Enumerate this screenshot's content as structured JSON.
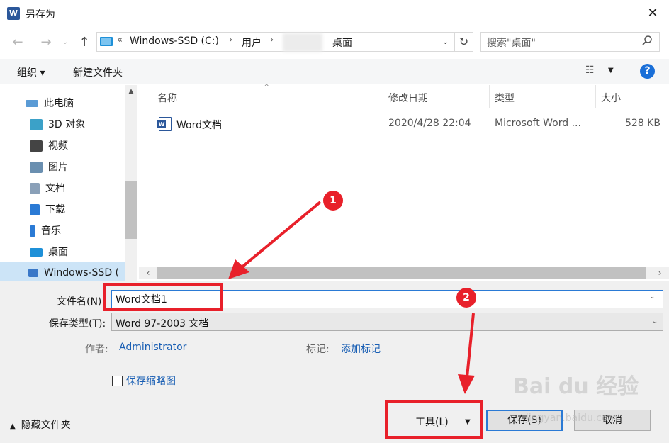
{
  "window": {
    "app_icon_glyph": "W",
    "title": "另存为",
    "close_glyph": "✕"
  },
  "navigation": {
    "back_glyph": "←",
    "forward_glyph": "→",
    "recent_glyph": "⌄",
    "up_glyph": "↑"
  },
  "address": {
    "overflow": "«",
    "crumbs": [
      "Windows-SSD (C:)",
      "用户",
      "桌面"
    ],
    "separator": "›",
    "dropdown_glyph": "⌄",
    "refresh_glyph": "↻"
  },
  "search": {
    "placeholder": "搜索\"桌面\"",
    "icon": "search-icon"
  },
  "toolbar": {
    "organize_label": "组织 ▾",
    "new_folder_label": "新建文件夹",
    "view_glyph": "☷",
    "view_dropdown_glyph": "▼",
    "help_glyph": "?"
  },
  "sidebar": {
    "items": [
      {
        "label": "此电脑",
        "icon": "computer-icon",
        "color": "#5a9bd5"
      },
      {
        "label": "3D 对象",
        "icon": "cube-icon",
        "color": "#3ba1c8"
      },
      {
        "label": "视频",
        "icon": "film-icon",
        "color": "#444444"
      },
      {
        "label": "图片",
        "icon": "picture-icon",
        "color": "#6a8fb0"
      },
      {
        "label": "文档",
        "icon": "document-icon",
        "color": "#8aa0b8"
      },
      {
        "label": "下载",
        "icon": "download-icon",
        "color": "#2a7ad5"
      },
      {
        "label": "音乐",
        "icon": "music-icon",
        "color": "#2a7ad5"
      },
      {
        "label": "桌面",
        "icon": "desktop-icon",
        "color": "#1e90d8"
      },
      {
        "label": "Windows-SSD (",
        "icon": "drive-icon",
        "color": "#3a78c8"
      }
    ]
  },
  "filelist": {
    "columns": [
      "名称",
      "修改日期",
      "类型",
      "大小"
    ],
    "sort_glyph": "^",
    "rows": [
      {
        "name": "Word文档",
        "modified": "2020/4/28 22:04",
        "type": "Microsoft Word ...",
        "size": "528 KB"
      }
    ]
  },
  "scroll": {
    "up": "▲",
    "down": "▼",
    "left": "‹",
    "right": "›"
  },
  "form": {
    "filename_label": "文件名(N):",
    "filename_value": "Word文档1",
    "savetype_label": "保存类型(T):",
    "savetype_value": "Word 97-2003 文档",
    "dropdown_glyph": "⌄",
    "author_label": "作者:",
    "author_value": "Administrator",
    "tags_label": "标记:",
    "tags_value": "添加标记",
    "thumbnail_label": "保存缩略图",
    "hide_folders_arrow": "▲",
    "hide_folders_label": "隐藏文件夹",
    "tools_label": "工具(L)",
    "tools_dropdown_glyph": "▼",
    "save_label": "保存(S)",
    "cancel_label": "取消"
  },
  "annotations": {
    "badge_1": "1",
    "badge_2": "2",
    "color": "#e8202a"
  },
  "watermark": {
    "text": "Bai du 经验",
    "sub": "jingyan.baidu.com"
  }
}
